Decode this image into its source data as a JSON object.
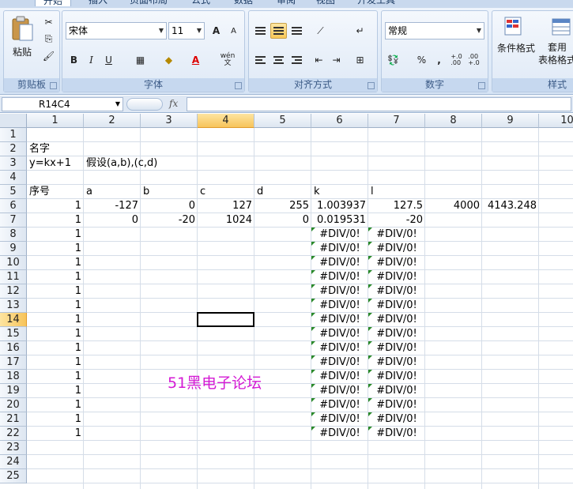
{
  "ribbon": {
    "tabs": [
      "开始",
      "插入",
      "页面布局",
      "公式",
      "数据",
      "审阅",
      "视图",
      "开发工具"
    ],
    "clipboard": {
      "paste_label": "粘贴",
      "group_label": "剪贴板"
    },
    "font": {
      "name": "宋体",
      "size": "11",
      "group_label": "字体",
      "bold": "B",
      "italic": "I",
      "underline": "U",
      "grow": "A",
      "shrink": "A",
      "font_color_glyph": "A",
      "phonetic": "wén\n文"
    },
    "alignment": {
      "group_label": "对齐方式"
    },
    "number": {
      "format": "常规",
      "group_label": "数字",
      "percent": "%",
      "comma": ",",
      "inc_decimal": "+.0\n.00",
      "dec_decimal": ".00\n+.0"
    },
    "styles": {
      "conditional_format": "条件格式",
      "table_format": "套用\n表格格式",
      "group_label": "样式"
    }
  },
  "formula_bar": {
    "name_box": "R14C4",
    "fx_label": "fx",
    "formula": ""
  },
  "columns": [
    "1",
    "2",
    "3",
    "4",
    "5",
    "6",
    "7",
    "8",
    "9",
    "10"
  ],
  "rows": [
    "1",
    "2",
    "3",
    "4",
    "5",
    "6",
    "7",
    "8",
    "9",
    "10",
    "11",
    "12",
    "13",
    "14",
    "15",
    "16",
    "17",
    "18",
    "19",
    "20",
    "21",
    "22",
    "23",
    "24",
    "25"
  ],
  "selected": {
    "row": "14",
    "col": "4"
  },
  "cells": {
    "r2c1": "名字",
    "r3c1": "y=kx+1",
    "r3c2": "假设(a,b),(c,d)",
    "r5c1": "序号",
    "r5c2": "a",
    "r5c3": "b",
    "r5c4": "c",
    "r5c5": "d",
    "r5c6": "k",
    "r5c7": "l",
    "r6c1": "1",
    "r6c2": "-127",
    "r6c3": "0",
    "r6c4": "127",
    "r6c5": "255",
    "r6c6": "1.003937",
    "r6c7": "127.5",
    "r6c8": "4000",
    "r6c9": "4143.248",
    "r7c1": "1",
    "r7c2": "0",
    "r7c3": "-20",
    "r7c4": "1024",
    "r7c5": "0",
    "r7c6": "0.019531",
    "r7c7": "-20",
    "seq": [
      "1",
      "1",
      "1",
      "1",
      "1",
      "1",
      "1",
      "1",
      "1",
      "1",
      "1",
      "1",
      "1",
      "1",
      "1"
    ],
    "div_error": "#DIV/0!"
  },
  "watermark": "51黑电子论坛"
}
